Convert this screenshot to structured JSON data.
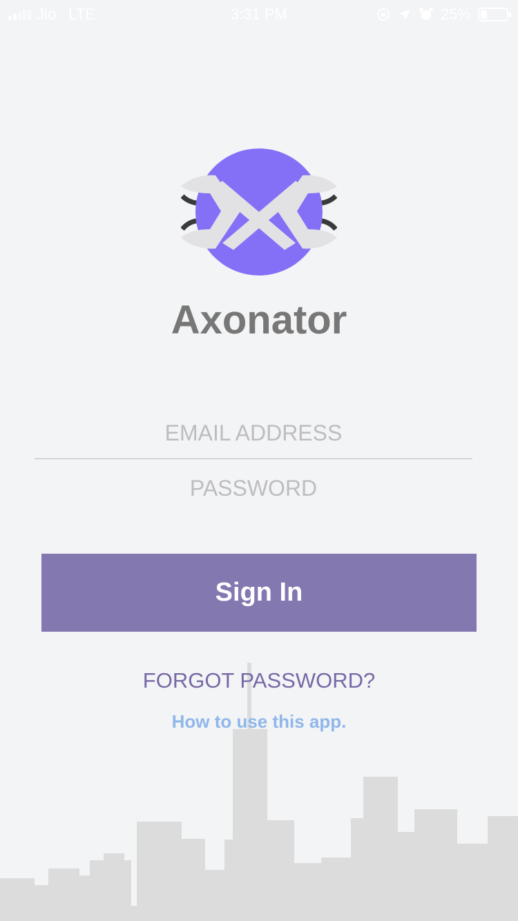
{
  "status_bar": {
    "carrier": "Jio",
    "network": "LTE",
    "time": "3:31 PM",
    "battery_percent_text": "25%",
    "battery_level": 0.25
  },
  "app": {
    "title": "Axonator",
    "brand_color": "#8470f7"
  },
  "form": {
    "email_placeholder": "EMAIL ADDRESS",
    "password_placeholder": "PASSWORD",
    "email_value": "",
    "password_value": ""
  },
  "actions": {
    "sign_in_label": "Sign In",
    "forgot_password_label": "FORGOT PASSWORD?",
    "how_to_label": "How to use this app."
  },
  "colors": {
    "background": "#f3f4f6",
    "button": "#8478b1",
    "forgot_text": "#7868a6",
    "howto_text": "#8fb7ea"
  }
}
